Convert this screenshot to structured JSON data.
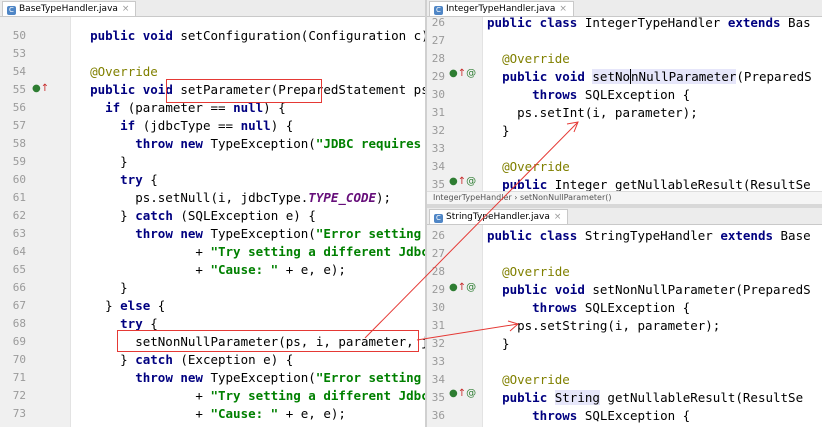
{
  "left": {
    "tab": "BaseTypeHandler.java",
    "lines": [
      {
        "n": "50",
        "html": "  <span class='kw'>public void</span> setConfiguration(Configuration c)"
      },
      {
        "n": "53",
        "html": ""
      },
      {
        "n": "54",
        "html": "  <span class='ann'>@Override</span>"
      },
      {
        "n": "55",
        "html": "  <span class='kw'>public void</span> setParameter(PreparedStatement ps,"
      },
      {
        "n": "56",
        "html": "    <span class='kw'>if</span> (parameter == <span class='kw'>null</span>) {"
      },
      {
        "n": "57",
        "html": "      <span class='kw'>if</span> (jdbcType == <span class='kw'>null</span>) {"
      },
      {
        "n": "58",
        "html": "        <span class='kw'>throw new</span> TypeException(<span class='str'>\"JDBC requires t</span>"
      },
      {
        "n": "59",
        "html": "      }"
      },
      {
        "n": "60",
        "html": "      <span class='kw'>try</span> {"
      },
      {
        "n": "61",
        "html": "        ps.setNull(i, jdbcType.<span class='fld'>TYPE_CODE</span>);"
      },
      {
        "n": "62",
        "html": "      } <span class='kw'>catch</span> (SQLException e) {"
      },
      {
        "n": "63",
        "html": "        <span class='kw'>throw new</span> TypeException(<span class='str'>\"Error setting n</span>"
      },
      {
        "n": "64",
        "html": "                + <span class='str'>\"Try setting a different JdbcTyp</span>"
      },
      {
        "n": "65",
        "html": "                + <span class='str'>\"Cause: \"</span> + e, e);"
      },
      {
        "n": "66",
        "html": "      }"
      },
      {
        "n": "67",
        "html": "    } <span class='kw'>else</span> {"
      },
      {
        "n": "68",
        "html": "      <span class='kw'>try</span> {"
      },
      {
        "n": "69",
        "html": "        setNonNullParameter(ps, i, parameter, jc"
      },
      {
        "n": "70",
        "html": "      } <span class='kw'>catch</span> (Exception e) {"
      },
      {
        "n": "71",
        "html": "        <span class='kw'>throw new</span> TypeException(<span class='str'>\"Error setting n</span>"
      },
      {
        "n": "72",
        "html": "                + <span class='str'>\"Try setting a different JdbcTyp</span>"
      },
      {
        "n": "73",
        "html": "                + <span class='str'>\"Cause: \"</span> + e, e);"
      }
    ]
  },
  "top_right": {
    "tab": "IntegerTypeHandler.java",
    "lines": [
      {
        "n": "26",
        "html": "<span class='kw'>public class</span> IntegerTypeHandler <span class='kw'>extends</span> Bas"
      },
      {
        "n": "27",
        "html": ""
      },
      {
        "n": "28",
        "html": "  <span class='ann'>@Override</span>"
      },
      {
        "n": "29",
        "html": "  <span class='kw'>public void</span> <span class='hl'>setNo<span class='cur'></span>nNullParameter</span>(PreparedS"
      },
      {
        "n": "30",
        "html": "      <span class='kw'>throws</span> SQLException {"
      },
      {
        "n": "31",
        "html": "    ps.setInt(i, parameter);"
      },
      {
        "n": "32",
        "html": "  }"
      },
      {
        "n": "33",
        "html": ""
      },
      {
        "n": "34",
        "html": "  <span class='ann'>@Override</span>"
      },
      {
        "n": "35",
        "html": "  <span class='kw'>public</span> Integer getNullableResult(ResultSe"
      }
    ],
    "breadcrumb": "IntegerTypeHandler  ›  setNonNullParameter()"
  },
  "bottom_right": {
    "tab": "StringTypeHandler.java",
    "lines": [
      {
        "n": "26",
        "html": "<span class='kw'>public class</span> StringTypeHandler <span class='kw'>extends</span> Base"
      },
      {
        "n": "27",
        "html": ""
      },
      {
        "n": "28",
        "html": "  <span class='ann'>@Override</span>"
      },
      {
        "n": "29",
        "html": "  <span class='kw'>public void</span> setNonNullParameter(PreparedS"
      },
      {
        "n": "30",
        "html": "      <span class='kw'>throws</span> SQLException {"
      },
      {
        "n": "31",
        "html": "    ps.setString(i, parameter);"
      },
      {
        "n": "32",
        "html": "  }"
      },
      {
        "n": "33",
        "html": ""
      },
      {
        "n": "34",
        "html": "  <span class='ann'>@Override</span>"
      },
      {
        "n": "35",
        "html": "  <span class='kw'>public</span> <span class='hl'>String</span> getNullableResult(ResultSe"
      },
      {
        "n": "36",
        "html": "      <span class='kw'>throws</span> SQLException {"
      }
    ]
  },
  "colors": {
    "keyword": "#000080",
    "annotation": "#808000",
    "string": "#008000",
    "annotation_box": "#e53935",
    "arrow": "#e53935"
  }
}
